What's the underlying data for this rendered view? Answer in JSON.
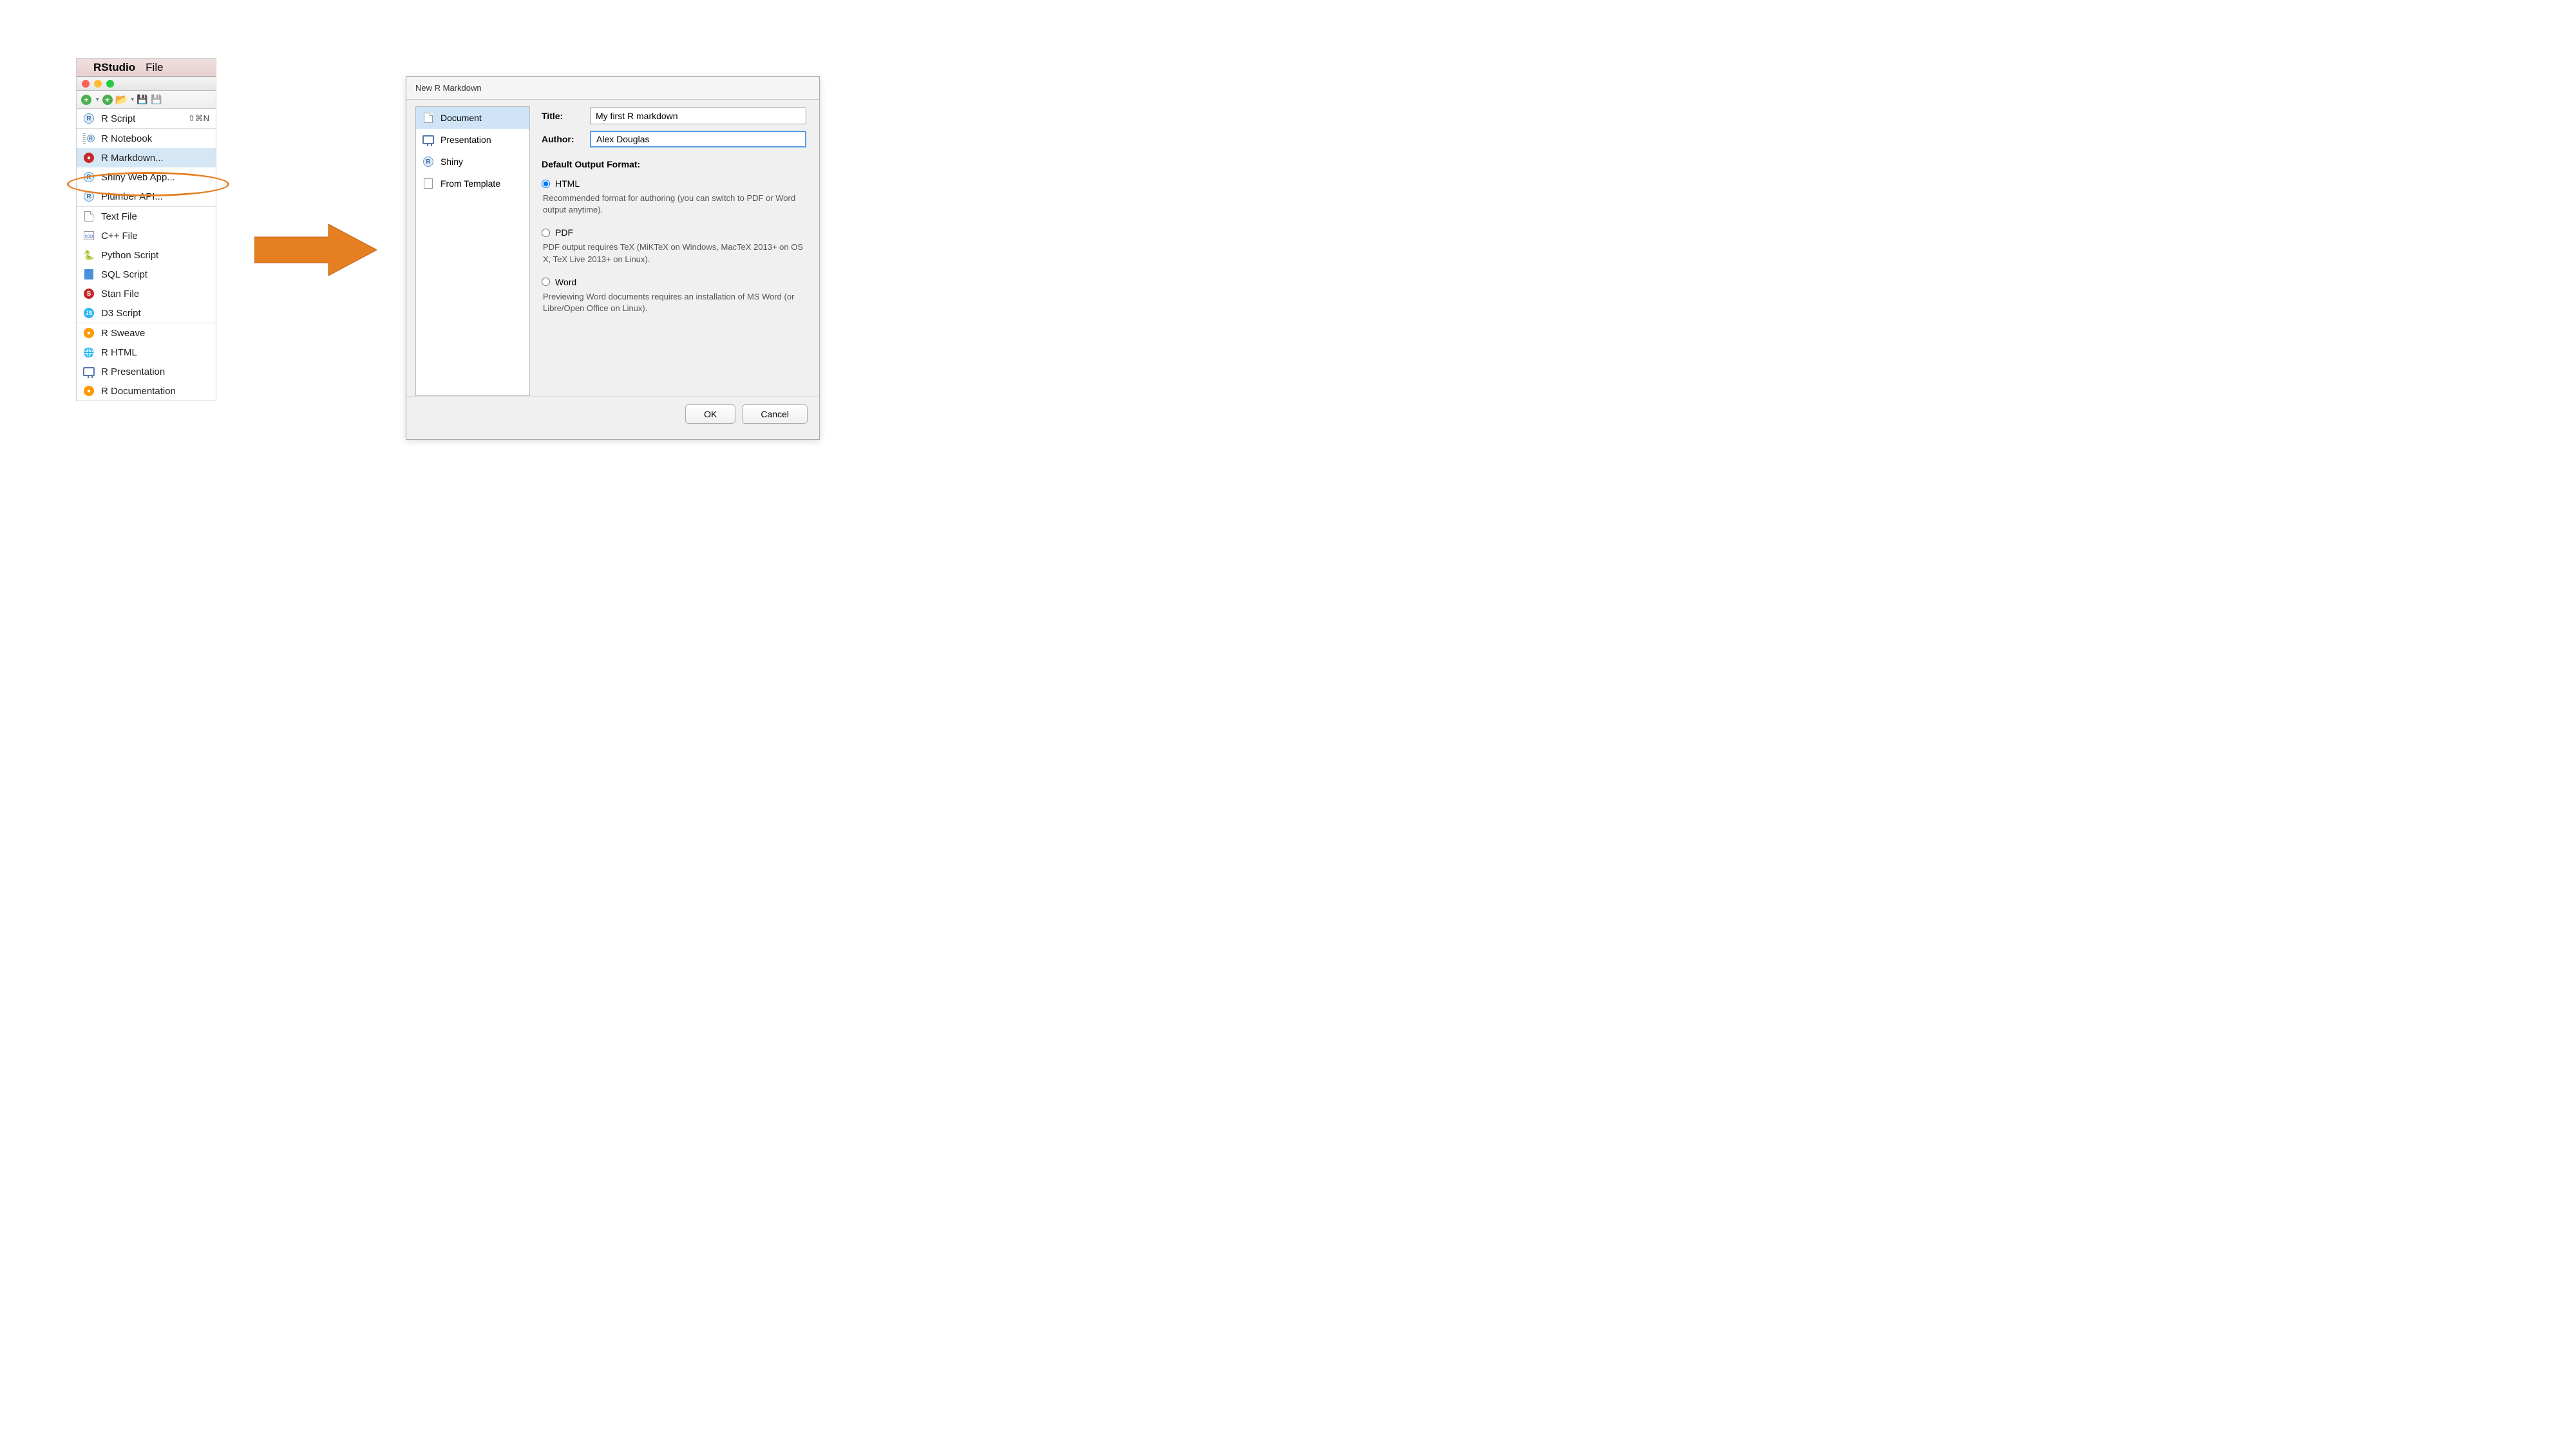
{
  "menubar": {
    "app_name": "RStudio",
    "file_menu": "File"
  },
  "menu": {
    "items": [
      {
        "label": "R Script",
        "shortcut": "⇧⌘N"
      },
      {
        "label": "R Notebook"
      },
      {
        "label": "R Markdown..."
      },
      {
        "label": "Shiny Web App..."
      },
      {
        "label": "Plumber API..."
      },
      {
        "label": "Text File"
      },
      {
        "label": "C++ File"
      },
      {
        "label": "Python Script"
      },
      {
        "label": "SQL Script"
      },
      {
        "label": "Stan File"
      },
      {
        "label": "D3 Script"
      },
      {
        "label": "R Sweave"
      },
      {
        "label": "R HTML"
      },
      {
        "label": "R Presentation"
      },
      {
        "label": "R Documentation"
      }
    ]
  },
  "dialog": {
    "title": "New R Markdown",
    "sidebar": {
      "items": [
        {
          "label": "Document"
        },
        {
          "label": "Presentation"
        },
        {
          "label": "Shiny"
        },
        {
          "label": "From Template"
        }
      ]
    },
    "form": {
      "title_label": "Title:",
      "title_value": "My first R markdown",
      "author_label": "Author:",
      "author_value": "Alex Douglas"
    },
    "output_heading": "Default Output Format:",
    "formats": [
      {
        "label": "HTML",
        "desc": "Recommended format for authoring (you can switch to PDF or Word output anytime)."
      },
      {
        "label": "PDF",
        "desc": "PDF output requires TeX (MiKTeX on Windows, MacTeX 2013+ on OS X, TeX Live 2013+ on Linux)."
      },
      {
        "label": "Word",
        "desc": "Previewing Word documents requires an installation of MS Word (or Libre/Open Office on Linux)."
      }
    ],
    "buttons": {
      "ok": "OK",
      "cancel": "Cancel"
    }
  }
}
